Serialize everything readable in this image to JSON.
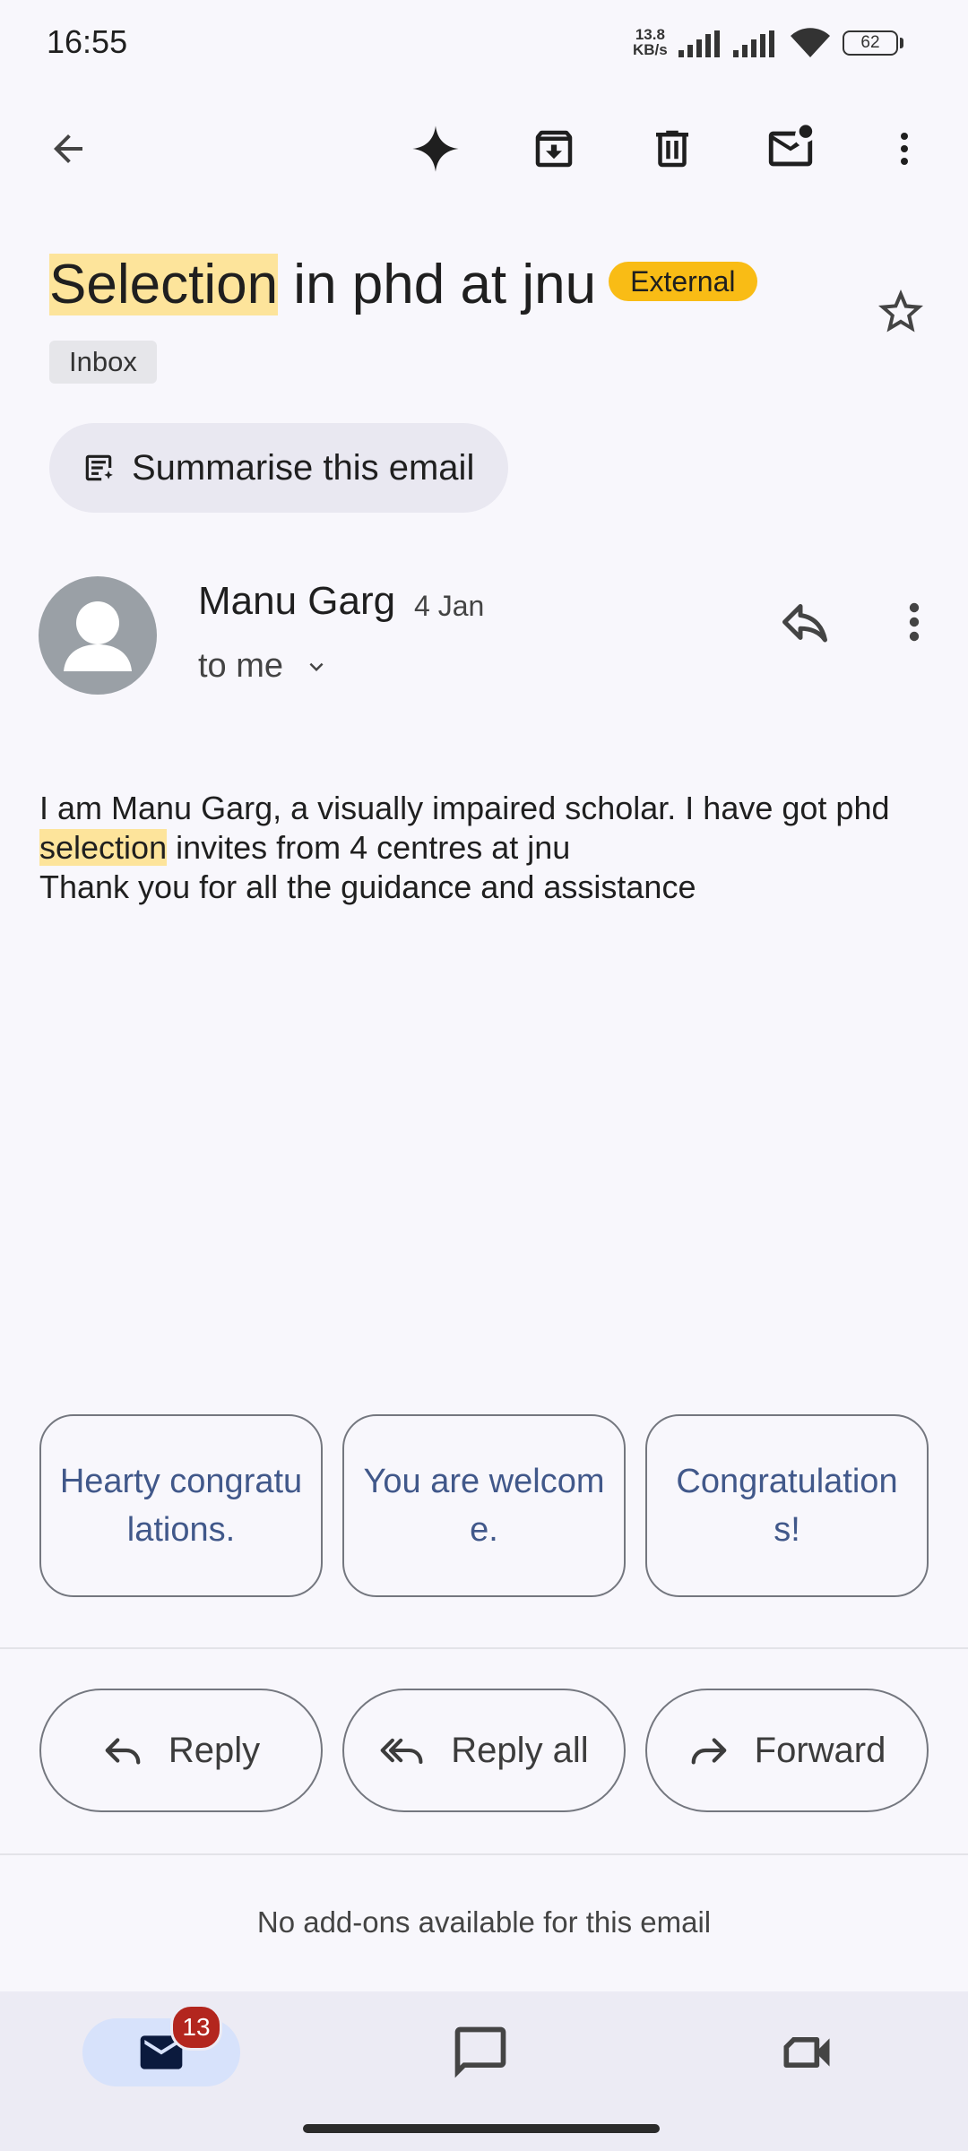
{
  "status_bar": {
    "time": "16:55",
    "net_speed_value": "13.8",
    "net_speed_unit": "KB/s",
    "battery": "62"
  },
  "toolbar": {
    "icons": [
      "back-arrow-icon",
      "sparkle-icon",
      "archive-icon",
      "delete-icon",
      "mark-unread-icon",
      "more-vert-icon"
    ]
  },
  "email": {
    "subject_highlight": "Selection",
    "subject_rest": " in phd at jnu",
    "external_badge": "External",
    "label": "Inbox",
    "summarise_label": "Summarise this email",
    "sender_name": "Manu Garg",
    "date": "4 Jan",
    "recipient": "to me",
    "body_line1": "I am Manu Garg, a visually impaired scholar. I have got phd",
    "body_line2_highlight": "selection",
    "body_line2_rest": " invites from 4 centres at jnu",
    "body_line3": "Thank you for all the guidance and assistance"
  },
  "smart_replies": [
    "Hearty congratulations.",
    "You are welcome.",
    "Congratulations!"
  ],
  "actions": {
    "reply": "Reply",
    "reply_all": "Reply all",
    "forward": "Forward"
  },
  "addons_note": "No add-ons available for this email",
  "bottom_nav": {
    "mail_badge": "13",
    "items": [
      "mail-icon",
      "chat-icon",
      "meet-icon"
    ]
  },
  "colors": {
    "highlight": "#fde49b",
    "external_badge": "#f9bc15",
    "smart_reply_text": "#41588a",
    "badge_red": "#b3261e"
  }
}
